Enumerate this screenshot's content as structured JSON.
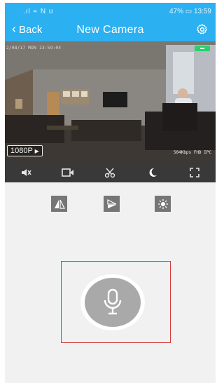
{
  "status_bar": {
    "left_icons": ".ıl ≈ N ʊ",
    "battery_time": "47% ▭ 13:59"
  },
  "nav": {
    "back_label": "Back",
    "title": "New Camera"
  },
  "video": {
    "timestamp": "2/08/17  MON 13:59:04",
    "resolution_label": "1080P",
    "bitrate_text": "504Kbps  FHD  IPC"
  },
  "colors": {
    "header": "#2bb0f2",
    "control_bar": "#393939",
    "ptz_button": "#767676",
    "talk_frame": "#d23a3a",
    "mic_button": "#a9a9a9"
  }
}
